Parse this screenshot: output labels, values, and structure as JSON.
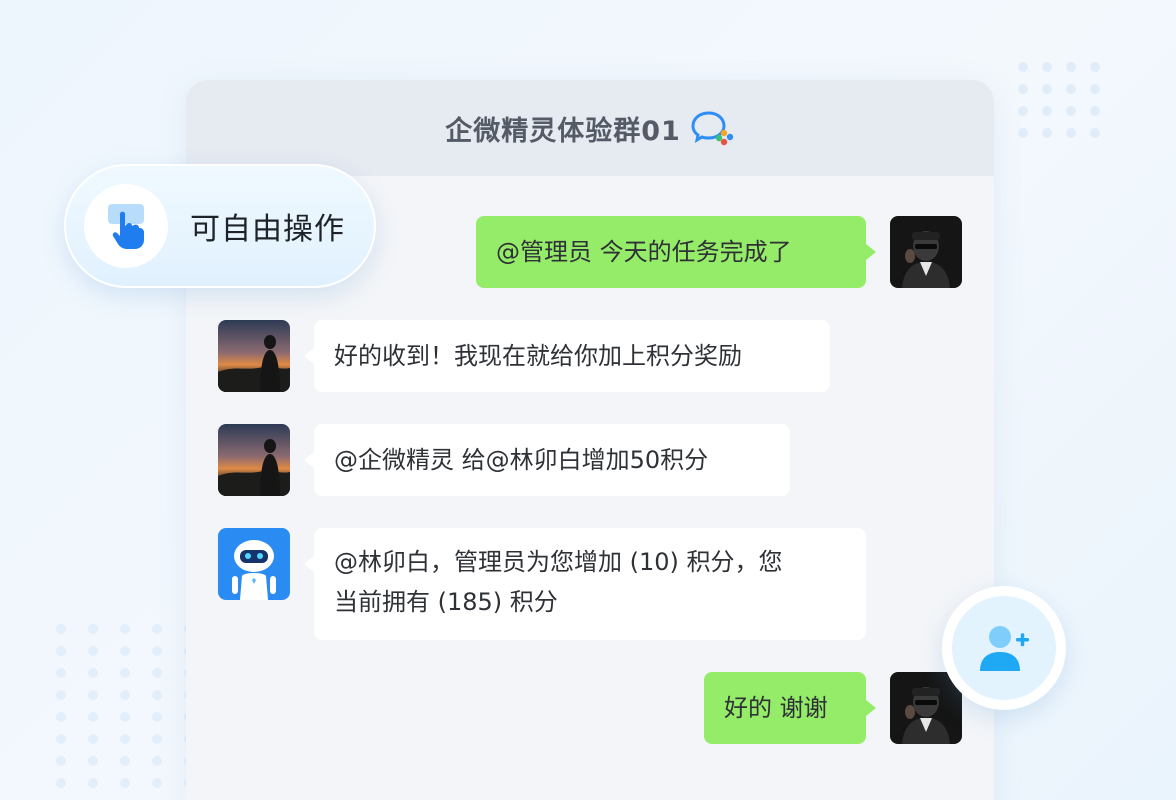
{
  "chat": {
    "title": "企微精灵体验群01"
  },
  "badge": {
    "label": "可自由操作"
  },
  "messages": [
    {
      "side": "right",
      "text": "@管理员  今天的任务完成了"
    },
    {
      "side": "left",
      "text": "好的收到！我现在就给你加上积分奖励"
    },
    {
      "side": "left",
      "text": "@企微精灵  给@林卯白增加50积分"
    },
    {
      "side": "left",
      "line1": "@林卯白，管理员为您增加 (10) 积分，您",
      "line2": "当前拥有 (185) 积分"
    },
    {
      "side": "right",
      "text": "好的 谢谢"
    }
  ],
  "colors": {
    "bubble_self": "#95ec69",
    "bubble_other": "#ffffff",
    "accent": "#2f8ef5"
  },
  "icons": {
    "header": "wecom-chat-icon",
    "badge": "tap-hand-icon",
    "add_user": "add-user-icon"
  }
}
